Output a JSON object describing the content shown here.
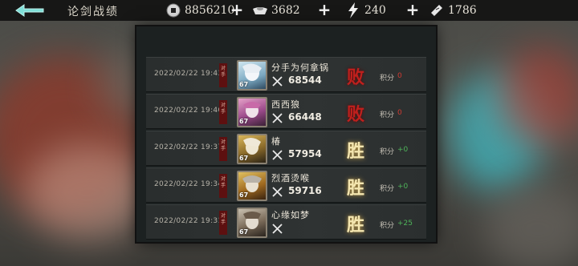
{
  "header": {
    "title": "论剑战绩",
    "resources": [
      {
        "icon": "coin-icon",
        "value": "8856210"
      },
      {
        "icon": "ingot-icon",
        "value": "3682"
      },
      {
        "icon": "energy-icon",
        "value": "240"
      },
      {
        "icon": "ticket-icon",
        "value": "1786"
      }
    ]
  },
  "records": {
    "score_label": "积分",
    "seal_text": "对手",
    "rows": [
      {
        "date": "2022/02/22 19:43",
        "name": "分手为何拿锅",
        "power": "68544",
        "result": "败",
        "outcome": "lose",
        "score": "0",
        "level": "67"
      },
      {
        "date": "2022/02/22 19:40",
        "name": "西西狼",
        "power": "66448",
        "result": "败",
        "outcome": "lose",
        "score": "0",
        "level": "67"
      },
      {
        "date": "2022/02/22 19:37",
        "name": "椿",
        "power": "57954",
        "result": "胜",
        "outcome": "win",
        "score": "+0",
        "level": "67"
      },
      {
        "date": "2022/02/22 19:34",
        "name": "烈酒烫喉",
        "power": "59716",
        "result": "胜",
        "outcome": "win",
        "score": "+0",
        "level": "67"
      },
      {
        "date": "2022/02/22 19:31",
        "name": "心缘如梦",
        "power": "",
        "result": "胜",
        "outcome": "win",
        "score": "+25",
        "level": "67"
      }
    ]
  },
  "colors": {
    "lose": "#c0201d",
    "win": "#f4e6b0",
    "score_win": "#4fb55a",
    "score_lose": "#d13a32"
  }
}
